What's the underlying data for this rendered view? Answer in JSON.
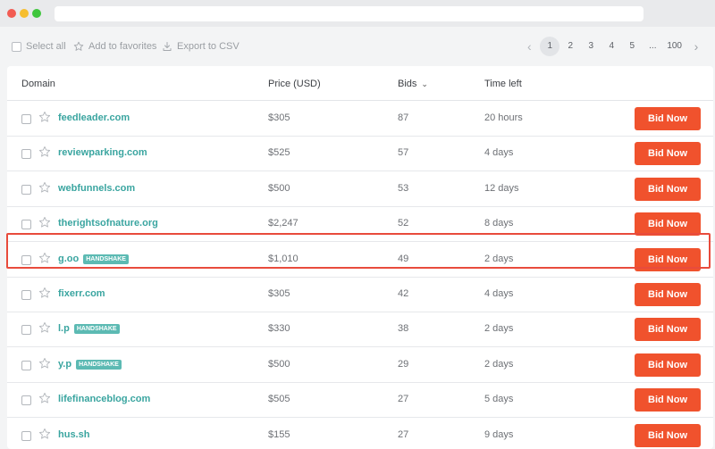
{
  "toolbar": {
    "select_all": "Select all",
    "add_favorites": "Add to favorites",
    "export_csv": "Export to CSV"
  },
  "pagination": {
    "pages": [
      "1",
      "2",
      "3",
      "4",
      "5",
      "...",
      "100"
    ],
    "current": "1"
  },
  "table": {
    "headers": {
      "domain": "Domain",
      "price": "Price (USD)",
      "bids": "Bids",
      "time_left": "Time left"
    },
    "rows": [
      {
        "domain": "feedleader.com",
        "badge": "",
        "price": "$305",
        "bids": "87",
        "time_left": "20 hours",
        "action": "Bid Now"
      },
      {
        "domain": "reviewparking.com",
        "badge": "",
        "price": "$525",
        "bids": "57",
        "time_left": "4 days",
        "action": "Bid Now"
      },
      {
        "domain": "webfunnels.com",
        "badge": "",
        "price": "$500",
        "bids": "53",
        "time_left": "12 days",
        "action": "Bid Now"
      },
      {
        "domain": "therightsofnature.org",
        "badge": "",
        "price": "$2,247",
        "bids": "52",
        "time_left": "8 days",
        "action": "Bid Now"
      },
      {
        "domain": "g.oo",
        "badge": "HANDSHAKE",
        "price": "$1,010",
        "bids": "49",
        "time_left": "2 days",
        "action": "Bid Now"
      },
      {
        "domain": "fixerr.com",
        "badge": "",
        "price": "$305",
        "bids": "42",
        "time_left": "4 days",
        "action": "Bid Now"
      },
      {
        "domain": "l.p",
        "badge": "HANDSHAKE",
        "price": "$330",
        "bids": "38",
        "time_left": "2 days",
        "action": "Bid Now"
      },
      {
        "domain": "y.p",
        "badge": "HANDSHAKE",
        "price": "$500",
        "bids": "29",
        "time_left": "2 days",
        "action": "Bid Now"
      },
      {
        "domain": "lifefinanceblog.com",
        "badge": "",
        "price": "$505",
        "bids": "27",
        "time_left": "5 days",
        "action": "Bid Now"
      },
      {
        "domain": "hus.sh",
        "badge": "",
        "price": "$155",
        "bids": "27",
        "time_left": "9 days",
        "action": "Bid Now"
      }
    ]
  },
  "colors": {
    "accent": "#f0522d",
    "link": "#3aa5a0",
    "badge": "#5cbab3",
    "highlight": "#e84b3c"
  }
}
